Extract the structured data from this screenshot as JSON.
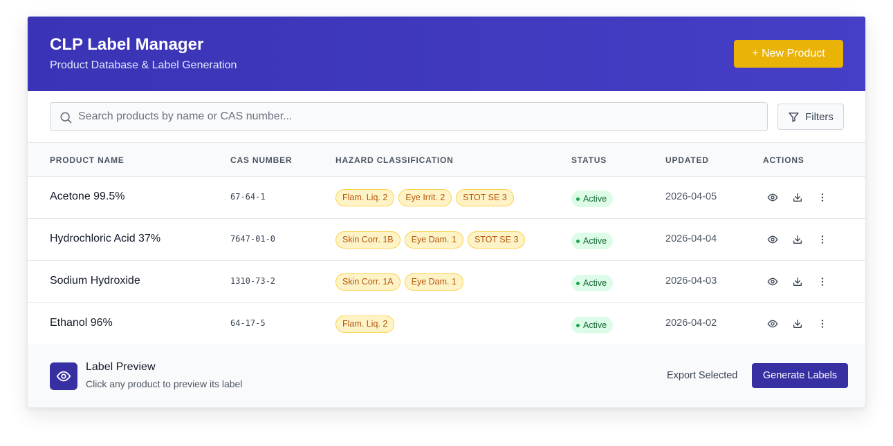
{
  "header": {
    "title": "CLP Label Manager",
    "subtitle": "Product Database & Label Generation",
    "new_product_label": "+ New Product"
  },
  "search": {
    "placeholder": "Search products by name or CAS number...",
    "value": "",
    "filters_label": "Filters"
  },
  "table": {
    "columns": [
      "Product Name",
      "CAS Number",
      "Hazard Classification",
      "Status",
      "Updated",
      "Actions"
    ],
    "rows": [
      {
        "name": "Acetone 99.5%",
        "cas": "67-64-1",
        "hazards": [
          "Flam. Liq. 2",
          "Eye Irrit. 2",
          "STOT SE 3"
        ],
        "status": "Active",
        "updated": "2026-04-05"
      },
      {
        "name": "Hydrochloric Acid 37%",
        "cas": "7647-01-0",
        "hazards": [
          "Skin Corr. 1B",
          "Eye Dam. 1",
          "STOT SE 3"
        ],
        "status": "Active",
        "updated": "2026-04-04"
      },
      {
        "name": "Sodium Hydroxide",
        "cas": "1310-73-2",
        "hazards": [
          "Skin Corr. 1A",
          "Eye Dam. 1"
        ],
        "status": "Active",
        "updated": "2026-04-03"
      },
      {
        "name": "Ethanol 96%",
        "cas": "64-17-5",
        "hazards": [
          "Flam. Liq. 2"
        ],
        "status": "Active",
        "updated": "2026-04-02"
      }
    ],
    "row_action_icons": [
      "eye-icon",
      "download-icon",
      "more-vertical-icon"
    ]
  },
  "footer": {
    "preview_title": "Label Preview",
    "preview_subtitle": "Click any product to preview its label",
    "export_label": "Export Selected",
    "generate_label": "Generate Labels"
  },
  "colors": {
    "header": "#3b33b5",
    "accent_button": "#eab308",
    "primary_button": "#3730a3",
    "hazard_chip_bg": "#fef3c7",
    "hazard_chip_text": "#b45309",
    "status_active_bg": "#dcfce7",
    "status_active_text": "#166534"
  }
}
